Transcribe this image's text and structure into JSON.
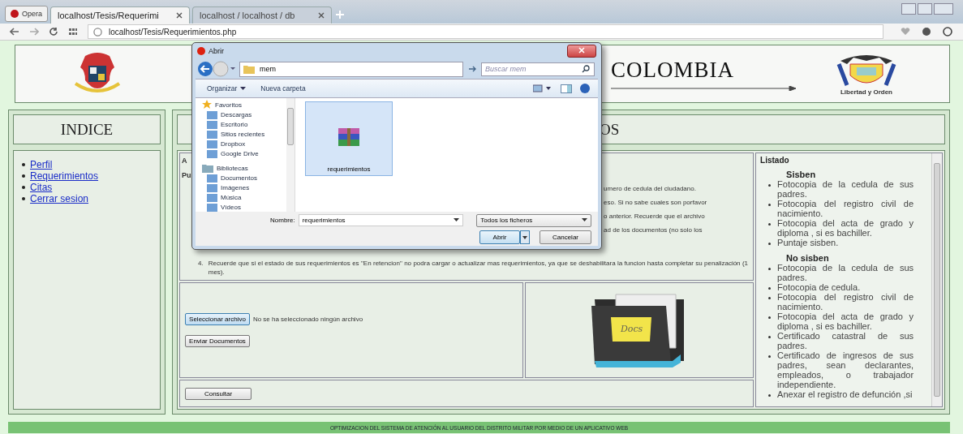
{
  "browser": {
    "menu_button": "Opera",
    "tabs": [
      {
        "label": "localhost/Tesis/Requerimi",
        "selected": true
      },
      {
        "label": "localhost / localhost / db",
        "selected": false
      }
    ],
    "address": "localhost/Tesis/Requerimientos.php"
  },
  "header": {
    "title_fragment": "COLOMBIA",
    "emblem_caption": "Libertad y Orden"
  },
  "sidebar": {
    "title": "INDICE",
    "links": [
      "Perfil",
      "Requerimientos",
      "Citas",
      "Cerrar sesion"
    ]
  },
  "main": {
    "title_fragment": "OS",
    "instructions": {
      "heading_fragment": "A",
      "subheading_fragment": "Pu",
      "line_fragments": [
        "umero de cedula del ciudadano.",
        "eso. Si no sabe cuales son porfavor",
        "o anterior. Recuerde que el archivo",
        "ad de los documentos (no solo los"
      ],
      "item_number": "4.",
      "item_text": "Recuerde que si el estado de sus requerimientos es \"En retencion\" no podra cargar o actualizar mas requerimientos, ya que se deshabilitara la funcion hasta completar su penalización (1 mes)."
    },
    "upload": {
      "choose_button": "Seleccionar archivo",
      "file_status": "No se ha seleccionado ningún archivo",
      "submit_button": "Enviar Documentos"
    },
    "folder_note": "Docs",
    "consult_button": "Consultar"
  },
  "listado": {
    "title": "Listado",
    "groups": [
      {
        "title": "Sisben",
        "items": [
          "Fotocopia de la cedula de sus padres.",
          "Fotocopia del registro civil de nacimiento.",
          "Fotocopia del acta de grado y diploma , si es bachiller.",
          "Puntaje sisben."
        ]
      },
      {
        "title": "No sisben",
        "items": [
          "Fotocopia de la cedula de sus padres.",
          "Fotocopia de cedula.",
          "Fotocopia del registro civil de nacimiento.",
          "Fotocopia del acta de grado y diploma , si es bachiller.",
          "Certificado catastral de sus padres.",
          "Certificado de ingresos de sus padres, sean declarantes, empleados, o trabajador independiente.",
          "Anexar el registro de defunción ,si"
        ]
      }
    ]
  },
  "footer": "OPTIMIZACION DEL SISTEMA DE ATENCIÓN AL USUARIO DEL DISTRITO MILITAR POR MEDIO DE UN APLICATIVO WEB",
  "dialog": {
    "title": "Abrir",
    "breadcrumb": "mem",
    "search_placeholder": "Buscar mem",
    "organize": "Organizar",
    "new_folder": "Nueva carpeta",
    "nav_sections": [
      {
        "title": "Favoritos",
        "items": [
          "Descargas",
          "Escritorio",
          "Sitios recientes",
          "Dropbox",
          "Google Drive"
        ]
      },
      {
        "title": "Bibliotecas",
        "items": [
          "Documentos",
          "Imágenes",
          "Música",
          "Vídeos"
        ]
      }
    ],
    "files": [
      {
        "name": "requerimientos",
        "selected": true
      }
    ],
    "filename_label": "Nombre:",
    "filename_value": "requerimientos",
    "filter": "Todos los ficheros",
    "open_button": "Abrir",
    "cancel_button": "Cancelar"
  }
}
